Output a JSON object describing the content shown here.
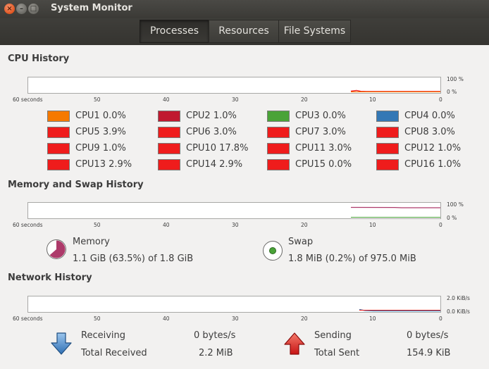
{
  "window": {
    "title": "System Monitor"
  },
  "tabs": [
    {
      "label": "Processes",
      "active": true
    },
    {
      "label": "Resources",
      "active": false
    },
    {
      "label": "File Systems",
      "active": false
    }
  ],
  "graph_axis": {
    "x_labels": [
      "60 seconds",
      "50",
      "40",
      "30",
      "20",
      "10",
      "0"
    ]
  },
  "cpu": {
    "title": "CPU History",
    "y_labels": [
      "100 %",
      "0 %"
    ],
    "items": [
      {
        "name": "CPU1",
        "value": "0.0%",
        "color": "#f57900"
      },
      {
        "name": "CPU2",
        "value": "1.0%",
        "color": "#c01930"
      },
      {
        "name": "CPU3",
        "value": "0.0%",
        "color": "#4aa338"
      },
      {
        "name": "CPU4",
        "value": "0.0%",
        "color": "#3478b5"
      },
      {
        "name": "CPU5",
        "value": "3.9%",
        "color": "#ef1c1c"
      },
      {
        "name": "CPU6",
        "value": "3.0%",
        "color": "#ef1c1c"
      },
      {
        "name": "CPU7",
        "value": "3.0%",
        "color": "#ef1c1c"
      },
      {
        "name": "CPU8",
        "value": "3.0%",
        "color": "#ef1c1c"
      },
      {
        "name": "CPU9",
        "value": "1.0%",
        "color": "#ef1c1c"
      },
      {
        "name": "CPU10",
        "value": "17.8%",
        "color": "#ef1c1c"
      },
      {
        "name": "CPU11",
        "value": "3.0%",
        "color": "#ef1c1c"
      },
      {
        "name": "CPU12",
        "value": "1.0%",
        "color": "#ef1c1c"
      },
      {
        "name": "CPU13",
        "value": "2.9%",
        "color": "#ef1c1c"
      },
      {
        "name": "CPU14",
        "value": "2.9%",
        "color": "#ef1c1c"
      },
      {
        "name": "CPU15",
        "value": "0.0%",
        "color": "#ef1c1c"
      },
      {
        "name": "CPU16",
        "value": "1.0%",
        "color": "#ef1c1c"
      }
    ]
  },
  "memory": {
    "title": "Memory and Swap History",
    "y_labels": [
      "100 %",
      "0 %"
    ],
    "memory_label": "Memory",
    "memory_value": "1.1 GiB (63.5%) of 1.8 GiB",
    "memory_fraction": 0.635,
    "memory_color": "#ad3a6a",
    "swap_label": "Swap",
    "swap_value": "1.8 MiB (0.2%) of 975.0 MiB",
    "swap_fraction": 0.002,
    "swap_color": "#4aa338"
  },
  "network": {
    "title": "Network History",
    "y_labels": [
      "2.0 KiB/s",
      "0.0 KiB/s"
    ],
    "receiving_label": "Receiving",
    "receiving_value": "0 bytes/s",
    "total_received_label": "Total Received",
    "total_received_value": "2.2 MiB",
    "sending_label": "Sending",
    "sending_value": "0 bytes/s",
    "total_sent_label": "Total Sent",
    "total_sent_value": "154.9 KiB",
    "receiving_color": "#3478b5",
    "sending_color": "#ef1c1c"
  }
}
